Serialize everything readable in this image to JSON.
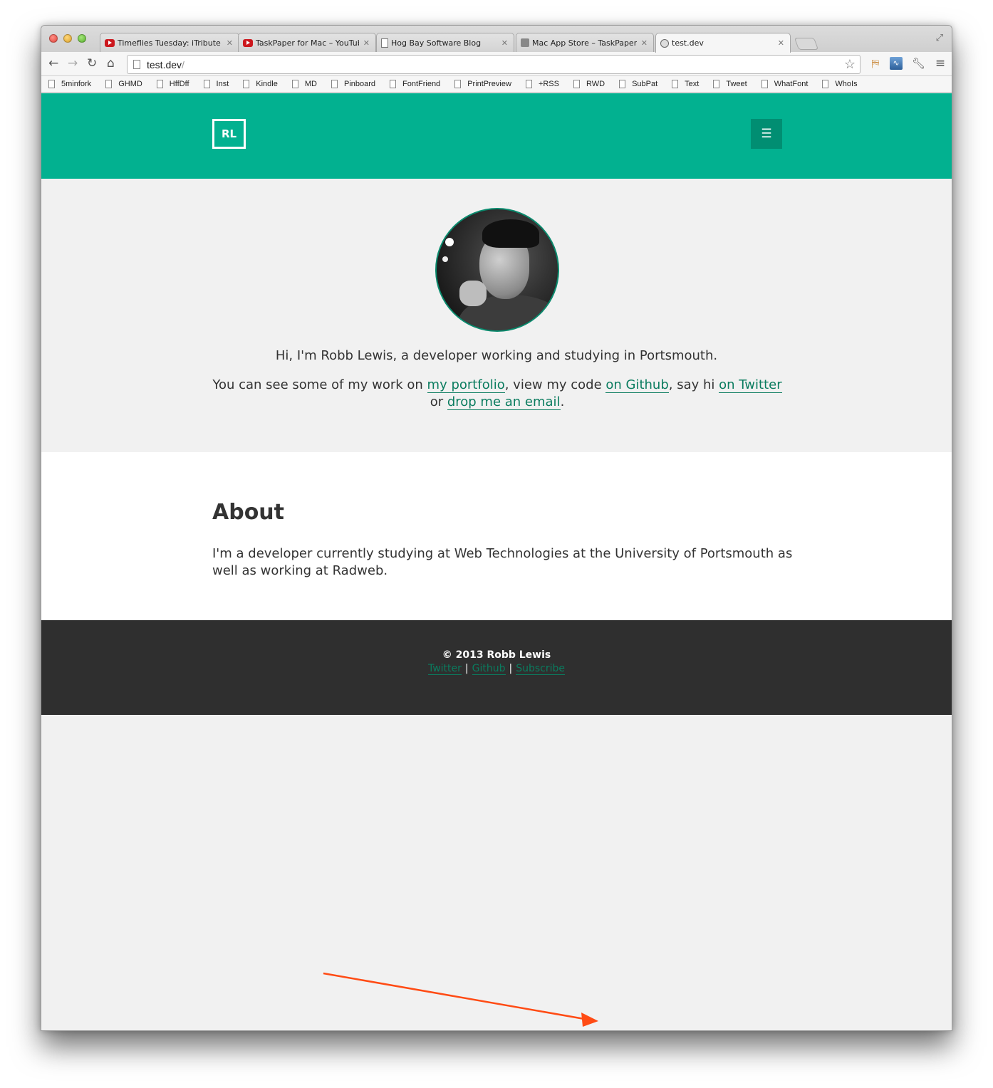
{
  "browser": {
    "tabs": [
      {
        "title": "Timeflies Tuesday: iTribute",
        "favicon": "youtube-icon"
      },
      {
        "title": "TaskPaper for Mac – YouTube",
        "favicon": "youtube-icon"
      },
      {
        "title": "Hog Bay Software Blog",
        "favicon": "page-icon"
      },
      {
        "title": "Mac App Store – TaskPaper",
        "favicon": "apple-icon"
      },
      {
        "title": "test.dev",
        "favicon": "globe-icon"
      }
    ],
    "tab_close_glyph": "✕",
    "url_host": "test.dev",
    "url_path": "/",
    "bookmarks": [
      "5minfork",
      "GHMD",
      "HffDff",
      "Inst",
      "Kindle",
      "MD",
      "Pinboard",
      "FontFriend",
      "PrintPreview",
      "+RSS",
      "RWD",
      "SubPat",
      "Text",
      "Tweet",
      "WhatFont",
      "WhoIs"
    ]
  },
  "site": {
    "logo_text": "RL",
    "menu_icon": "hamburger-icon",
    "accent_color": "#02b190",
    "link_color": "#0a7c5f",
    "intro": "Hi, I'm Robb Lewis, a developer working and studying in Portsmouth.",
    "links_para": {
      "t1": "You can see some of my work on ",
      "portfolio": "my portfolio",
      "t2": ", view my code ",
      "github": "on Github",
      "t3": ", say hi ",
      "twitter": "on Twitter",
      "t4": " or ",
      "email": "drop me an email",
      "t5": "."
    },
    "about": {
      "heading": "About",
      "body": "I'm a developer currently studying at Web Technologies at the University of Portsmouth as well as working at Radweb."
    },
    "footer": {
      "copyright": "© 2013 Robb Lewis",
      "links": [
        "Twitter",
        "Github",
        "Subscribe"
      ],
      "separator": "|"
    }
  },
  "annotation": {
    "arrow_color": "#ff4b14"
  }
}
